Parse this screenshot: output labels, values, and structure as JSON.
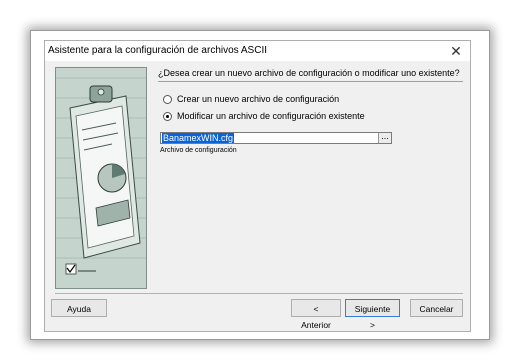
{
  "window": {
    "title": "Asistente para la configuración de archivos ASCII",
    "close_icon": "close-icon"
  },
  "main": {
    "question": "¿Desea crear un nuevo archivo de configuración o modificar uno existente?",
    "options": [
      {
        "label": "Crear un nuevo archivo de configuración",
        "checked": false
      },
      {
        "label": "Modificar un archivo de configuración existente",
        "checked": true
      }
    ],
    "file_input": {
      "value": "BanamexWIN.cfg",
      "browse_label": "..."
    },
    "file_caption": "Archivo de configuración"
  },
  "buttons": {
    "help": "Ayuda",
    "back": "< Anterior",
    "next": "Siguiente >",
    "cancel": "Cancelar"
  },
  "colors": {
    "selection": "#0a64d8",
    "dialog_bg": "#f0f0f0",
    "default_button_border": "#3a7bd5"
  }
}
